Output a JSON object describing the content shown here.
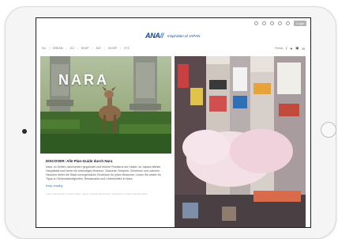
{
  "header": {
    "brand": "ANA",
    "tagline": "Inspiration of JAPAN",
    "login_label": "Login"
  },
  "nav": {
    "items": [
      "Kul",
      "DREAM",
      "DO",
      "SHOP",
      "EAT",
      "SLEEP",
      "ETC"
    ]
  },
  "follow": {
    "label": "Follow",
    "icons": [
      "facebook-icon",
      "twitter-icon",
      "instagram-icon",
      "linkedin-icon"
    ]
  },
  "featured": {
    "overlay_title": "NARA",
    "article_title": "DISCOVER: Alle Plan-Guide durch Nara",
    "body": "Nara, im fünften Jahrhundert gegründet und frühere Residenz der Kaiser, ist Japans älteste Hauptstadt und heute ein lebendiges Museum. Zwischen Tempeln, Schreinen und zahmen Hirschen bietet die Stadt unvergessliche Eindrücke für jeden Besucher. Lesen Sie weiter für Tipps zu Sehenswürdigkeiten, Restaurants und Unterkünften in Nara.",
    "read_more": "Keep reading",
    "tags": "Kultur, Geschichte, Tempel, Natur, Japan, Kansai, Reiseführer, Nara Park, Todaiji, Kasuga Taisha"
  },
  "colors": {
    "brand_blue": "#13448f",
    "accent_blue": "#2f7fd8",
    "link_blue": "#2d6fc2"
  }
}
